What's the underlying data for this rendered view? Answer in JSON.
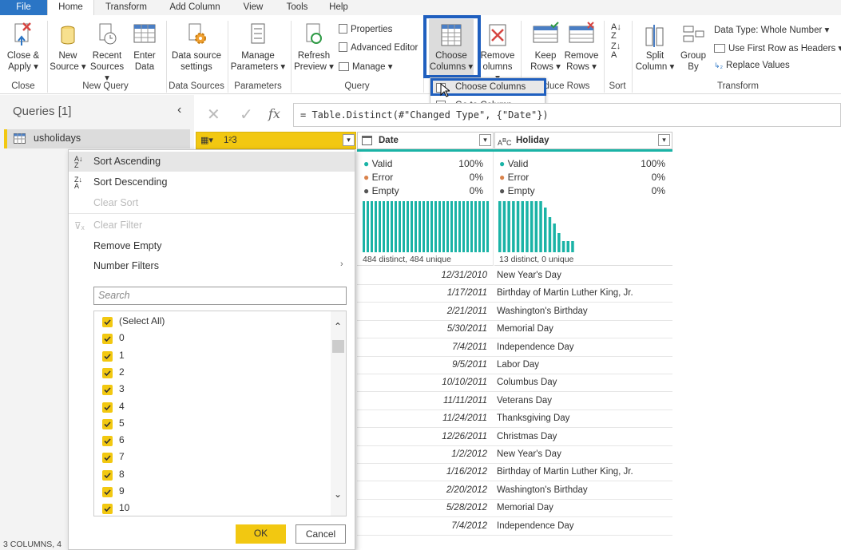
{
  "tabs": [
    "File",
    "Home",
    "Transform",
    "Add Column",
    "View",
    "Tools",
    "Help"
  ],
  "ribbon": {
    "close_apply": [
      "Close &",
      "Apply"
    ],
    "new_source": [
      "New",
      "Source"
    ],
    "recent_sources": [
      "Recent",
      "Sources"
    ],
    "enter_data": [
      "Enter",
      "Data"
    ],
    "data_source_settings": [
      "Data source",
      "settings"
    ],
    "manage_parameters": [
      "Manage",
      "Parameters"
    ],
    "refresh_preview": [
      "Refresh",
      "Preview"
    ],
    "properties": "Properties",
    "advanced_editor": "Advanced Editor",
    "manage": "Manage",
    "choose_columns": [
      "Choose",
      "Columns"
    ],
    "remove_columns": [
      "Remove",
      "olumns"
    ],
    "keep_rows": [
      "Keep",
      "Rows"
    ],
    "remove_rows": [
      "Remove",
      "Rows"
    ],
    "split_column": [
      "Split",
      "Column"
    ],
    "group_by": [
      "Group",
      "By"
    ],
    "data_type": "Data Type: Whole Number",
    "first_row_headers": "Use First Row as Headers",
    "replace_values": "Replace Values",
    "groups": {
      "close": "Close",
      "new_query": "New Query",
      "data_sources": "Data Sources",
      "parameters": "Parameters",
      "query": "Query",
      "reduce_rows": "duce Rows",
      "sort": "Sort",
      "transform": "Transform"
    }
  },
  "choose_menu": {
    "choose_columns": "Choose Columns",
    "go_to_column": "Go to Column"
  },
  "queries": {
    "title": "Queries [1]",
    "item": "usholidays"
  },
  "formula": "= Table.Distinct(#\"Changed Type\", {\"Date\"})",
  "columns": {
    "c1": {
      "type": "1²3"
    },
    "date": {
      "name": "Date",
      "valid": "Valid",
      "valid_pct": "100%",
      "error": "Error",
      "error_pct": "0%",
      "empty": "Empty",
      "empty_pct": "0%",
      "distinct": "484 distinct, 484 unique"
    },
    "holiday": {
      "name": "Holiday",
      "valid": "Valid",
      "valid_pct": "100%",
      "error": "Error",
      "error_pct": "0%",
      "empty": "Empty",
      "empty_pct": "0%",
      "distinct": "13 distinct, 0 unique"
    }
  },
  "rows": [
    [
      "12/31/2010",
      "New Year's Day"
    ],
    [
      "1/17/2011",
      "Birthday of Martin Luther King, Jr."
    ],
    [
      "2/21/2011",
      "Washington's Birthday"
    ],
    [
      "5/30/2011",
      "Memorial Day"
    ],
    [
      "7/4/2011",
      "Independence Day"
    ],
    [
      "9/5/2011",
      "Labor Day"
    ],
    [
      "10/10/2011",
      "Columbus Day"
    ],
    [
      "11/11/2011",
      "Veterans Day"
    ],
    [
      "11/24/2011",
      "Thanksgiving Day"
    ],
    [
      "12/26/2011",
      "Christmas Day"
    ],
    [
      "1/2/2012",
      "New Year's Day"
    ],
    [
      "1/16/2012",
      "Birthday of Martin Luther King, Jr."
    ],
    [
      "2/20/2012",
      "Washington's Birthday"
    ],
    [
      "5/28/2012",
      "Memorial Day"
    ],
    [
      "7/4/2012",
      "Independence Day"
    ]
  ],
  "filter_menu": {
    "sort_asc": "Sort Ascending",
    "sort_desc": "Sort Descending",
    "clear_sort": "Clear Sort",
    "clear_filter": "Clear Filter",
    "remove_empty": "Remove Empty",
    "number_filters": "Number Filters",
    "search_placeholder": "Search",
    "items": [
      "(Select All)",
      "0",
      "1",
      "2",
      "3",
      "4",
      "5",
      "6",
      "7",
      "8",
      "9",
      "10"
    ],
    "ok": "OK",
    "cancel": "Cancel"
  },
  "status": "3 COLUMNS, 4",
  "colors": {
    "accent": "#f2c811",
    "teal": "#1ab3a6",
    "blue": "#2b75c5",
    "highlight": "#1f5fbf"
  }
}
